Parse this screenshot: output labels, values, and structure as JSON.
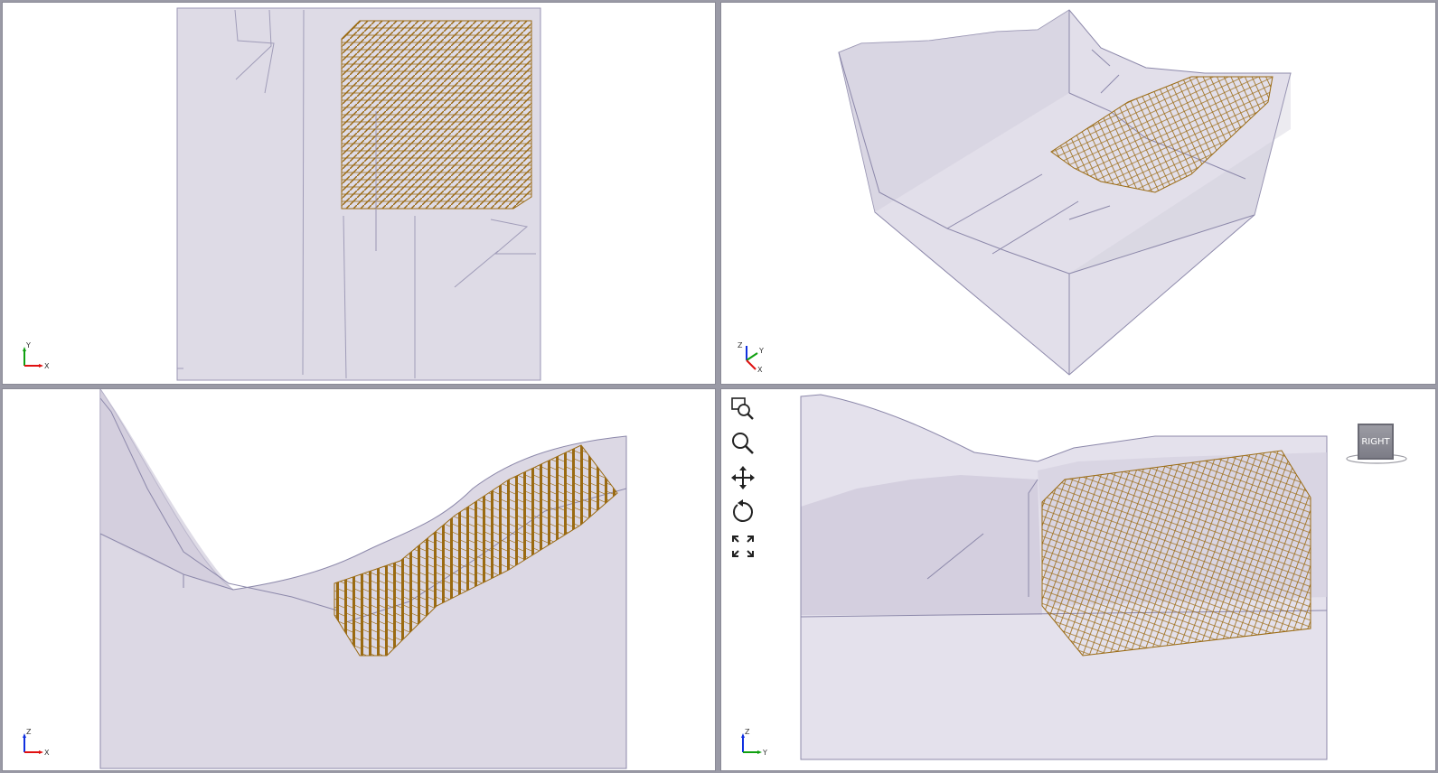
{
  "viewports": [
    {
      "id": "top",
      "axes": {
        "up": "Y",
        "right": "X"
      }
    },
    {
      "id": "perspective",
      "axes": {
        "up": "Z",
        "right": "X",
        "depth": "Y"
      }
    },
    {
      "id": "front",
      "axes": {
        "up": "Z",
        "right": "X"
      }
    },
    {
      "id": "right",
      "axes": {
        "up": "Z",
        "right": "Y"
      }
    }
  ],
  "toolbar": {
    "tools": [
      {
        "icon": "zoom-window-icon"
      },
      {
        "icon": "zoom-icon"
      },
      {
        "icon": "pan-icon"
      },
      {
        "icon": "rotate-icon"
      },
      {
        "icon": "zoom-extents-icon"
      }
    ]
  },
  "viewcube": {
    "face_label": "RIGHT"
  },
  "colors": {
    "terrain_fill": "#dcd8e4",
    "terrain_edge": "#8c88aa",
    "mesh": "#9a6a12",
    "axis_x": "#e01010",
    "axis_y": "#10a010",
    "axis_z": "#1030e0"
  }
}
